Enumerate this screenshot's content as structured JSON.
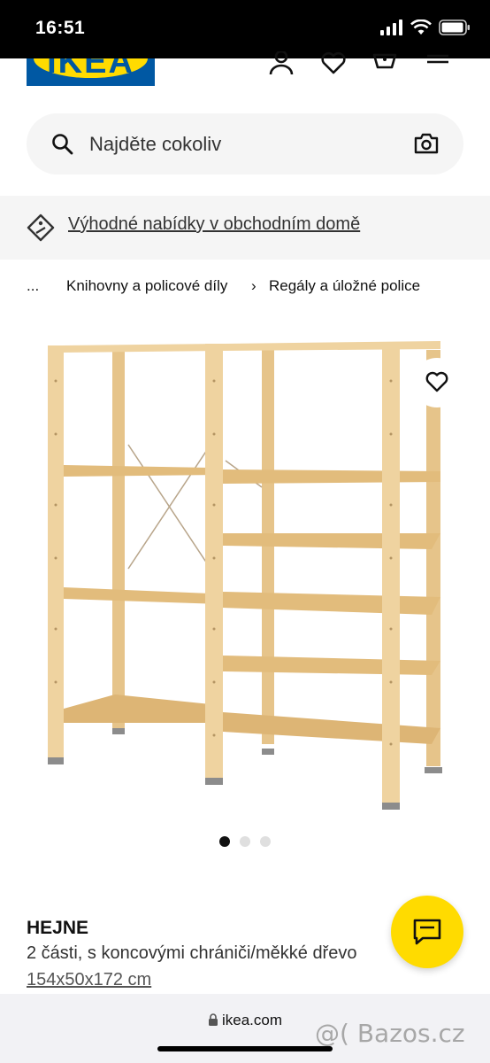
{
  "status_bar": {
    "time": "16:51"
  },
  "header": {
    "logo_text": "IKEA"
  },
  "search": {
    "placeholder": "Najděte cokoliv"
  },
  "promo": {
    "text": "Výhodné nabídky v obchodním domě"
  },
  "breadcrumb": {
    "ellipsis": "...",
    "items": [
      "Knihovny a policové díly",
      "Regály a úložné police"
    ],
    "separator": "›"
  },
  "gallery": {
    "total_images": 3,
    "active_index": 1
  },
  "product": {
    "name": "HEJNE",
    "description": "2 části, s koncovými chrániči/měkké dřevo",
    "dimensions": "154x50x172 cm"
  },
  "browser": {
    "url": "ikea.com"
  },
  "watermark": {
    "text": "@( Bazos.cz"
  },
  "colors": {
    "ikea_blue": "#0058a3",
    "ikea_yellow": "#ffdb00",
    "wood": "#e9c98f"
  }
}
